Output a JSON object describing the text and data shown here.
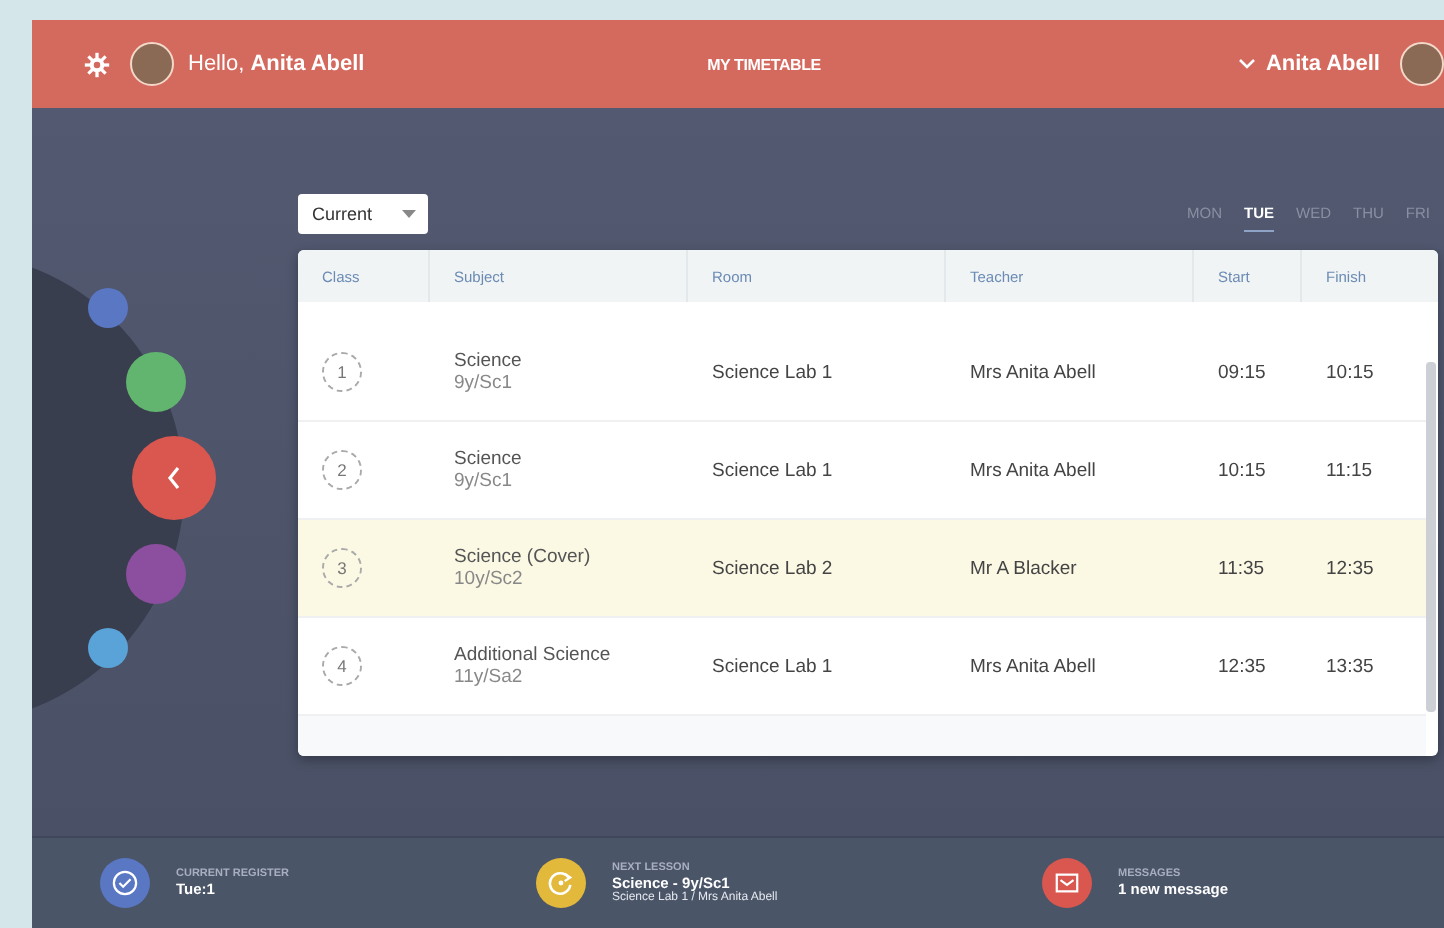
{
  "header": {
    "greeting": "Hello, **Anita Abell**",
    "title": "MY TIMETABLE",
    "user_name": "Anita Abell"
  },
  "arc_menu": [
    {
      "kind": "dot",
      "color": "#5a77c4"
    },
    {
      "kind": "dot",
      "color": "#62b56f"
    },
    {
      "kind": "back"
    },
    {
      "kind": "dot",
      "color": "#8c4fa0"
    },
    {
      "kind": "dot",
      "color": "#5aa3d8"
    }
  ],
  "period_select": {
    "value": "Current"
  },
  "days": [
    {
      "label": "MON",
      "selected": false
    },
    {
      "label": "TUE",
      "selected": true
    },
    {
      "label": "WED",
      "selected": false
    },
    {
      "label": "THU",
      "selected": false
    },
    {
      "label": "FRI",
      "selected": false
    }
  ],
  "table": {
    "columns": [
      "Class",
      "Subject",
      "Room",
      "Teacher",
      "Start",
      "Finish"
    ],
    "rows": [
      {
        "class": "1",
        "subject": "Science",
        "group": "9y/Sc1",
        "room": "Science Lab 1",
        "teacher": "Mrs Anita Abell",
        "start": "09:15",
        "finish": "10:15",
        "selected": false
      },
      {
        "class": "2",
        "subject": "Science",
        "group": "9y/Sc1",
        "room": "Science Lab 1",
        "teacher": "Mrs Anita Abell",
        "start": "10:15",
        "finish": "11:15",
        "selected": false
      },
      {
        "class": "3",
        "subject": "Science (Cover)",
        "group": "10y/Sc2",
        "room": "Science Lab 2",
        "teacher": "Mr A Blacker",
        "start": "11:35",
        "finish": "12:35",
        "selected": true
      },
      {
        "class": "4",
        "subject": "Additional Science",
        "group": "11y/Sa2",
        "room": "Science Lab 1",
        "teacher": "Mrs Anita Abell",
        "start": "12:35",
        "finish": "13:35",
        "selected": false
      }
    ]
  },
  "status_bar": [
    {
      "kind": "register",
      "label": "CURRENT REGISTER",
      "value": "Tue:1"
    },
    {
      "kind": "lesson",
      "label": "NEXT LESSON",
      "value": "Science - 9y/Sc1",
      "detail": "Science Lab 1 / Mrs Anita Abell"
    },
    {
      "kind": "messages",
      "label": "MESSAGES",
      "value": "1 new message"
    }
  ]
}
